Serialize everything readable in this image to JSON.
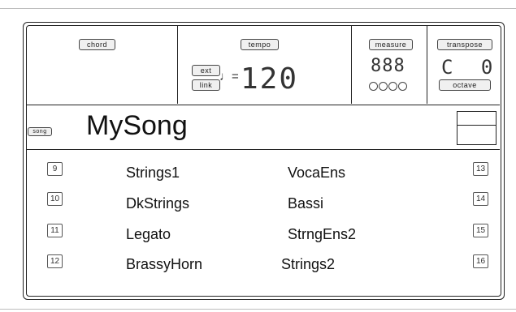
{
  "header": {
    "chord_label": "chord",
    "tempo_label": "tempo",
    "ext_label": "ext",
    "link_label": "link",
    "note_equals": "♩=",
    "tempo_value": "120",
    "measure_label": "measure",
    "measure_value": "888",
    "transpose_label": "transpose",
    "transpose_value": "C 0",
    "octave_label": "octave"
  },
  "song": {
    "badge": "song",
    "name": "MySong"
  },
  "tracks": [
    {
      "num_left": "9",
      "left": "Strings1",
      "right": "VocaEns",
      "num_right": "13"
    },
    {
      "num_left": "10",
      "left": "DkStrings",
      "right": "Bassi",
      "num_right": "14"
    },
    {
      "num_left": "11",
      "left": "Legato",
      "right": "StrngEns2",
      "num_right": "15"
    },
    {
      "num_left": "12",
      "left": "BrassyHorn",
      "right": "Strings2",
      "num_right": "16"
    }
  ]
}
